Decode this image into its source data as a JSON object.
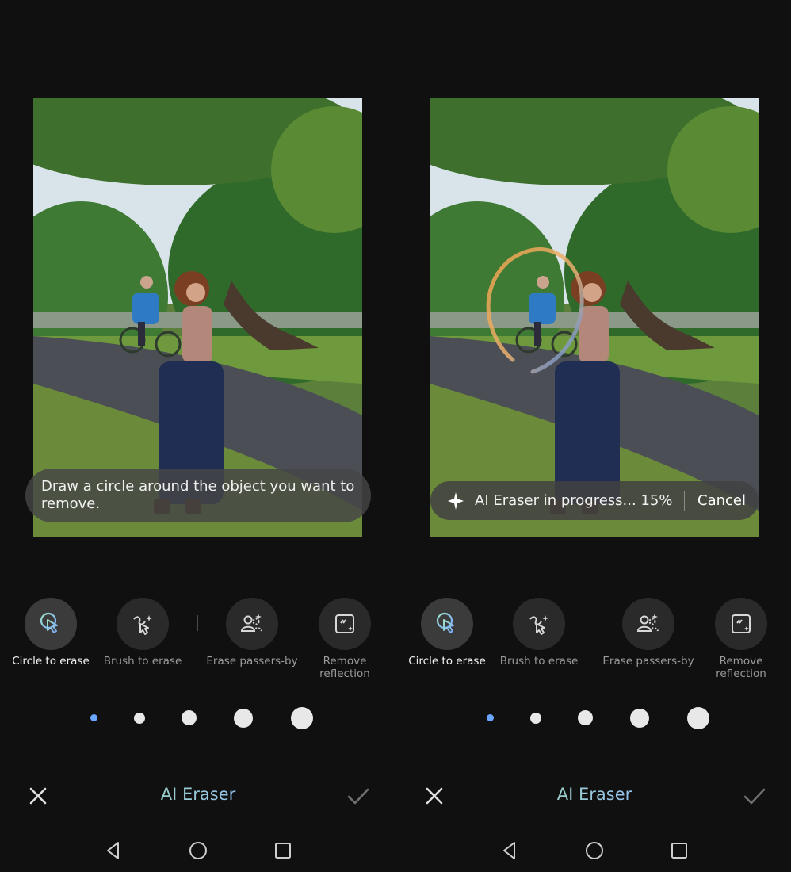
{
  "left": {
    "hint": "Draw a circle around the object you want to remove."
  },
  "right": {
    "progress": "AI Eraser in progress... 15%",
    "cancel": "Cancel"
  },
  "tools": [
    {
      "label": "Circle to erase",
      "icon": "circle-touch-icon",
      "active": true
    },
    {
      "label": "Brush to erase",
      "icon": "brush-touch-icon",
      "active": false
    },
    {
      "label": "Erase passers-by",
      "icon": "people-sparkle-icon",
      "active": false
    },
    {
      "label": "Remove reflection",
      "icon": "reflection-icon",
      "active": false
    }
  ],
  "brush_sizes": {
    "count": 5,
    "selected_index": 0
  },
  "bottom_bar": {
    "title": "AI Eraser",
    "close_icon": "close-icon",
    "confirm_icon": "check-icon"
  },
  "nav": {
    "back": "back-icon",
    "home": "home-icon",
    "recents": "recents-icon"
  },
  "colors": {
    "accent": "#6aa7ff",
    "background": "#101010",
    "title_gradient_start": "#9fd8b8",
    "title_gradient_end": "#8fb8ff"
  }
}
